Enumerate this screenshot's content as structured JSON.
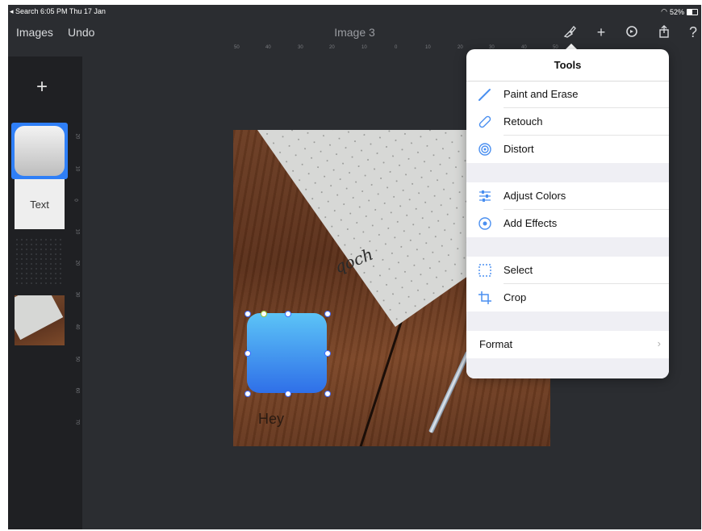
{
  "status": {
    "left": "◂ Search  6:05 PM  Thu 17 Jan",
    "right": "52%"
  },
  "nav": {
    "images_label": "Images",
    "undo_label": "Undo",
    "title": "Image 3",
    "icons": [
      "brush-icon",
      "plus-icon",
      "settings-icon",
      "share-icon",
      "help-icon"
    ],
    "plus_glyph": "+",
    "help_glyph": "?"
  },
  "ruler_top": [
    "50",
    "40",
    "30",
    "20",
    "10",
    "0",
    "10",
    "20",
    "30",
    "40",
    "50"
  ],
  "ruler_left": [
    "20",
    "10",
    "0",
    "10",
    "20",
    "30",
    "40",
    "50",
    "60",
    "70"
  ],
  "sidebar": {
    "add_glyph": "+",
    "layers": [
      {
        "name": "rounded-rect-layer",
        "label": ""
      },
      {
        "name": "text-layer",
        "label": "Text"
      },
      {
        "name": "empty-layer",
        "label": ""
      },
      {
        "name": "photo-layer",
        "label": ""
      }
    ]
  },
  "canvas": {
    "caption_text": "Hey",
    "script_text": "qoch"
  },
  "tools": {
    "title": "Tools",
    "group1": [
      "Paint and Erase",
      "Retouch",
      "Distort"
    ],
    "group2": [
      "Adjust Colors",
      "Add Effects"
    ],
    "group3": [
      "Select",
      "Crop"
    ],
    "format_label": "Format",
    "chevron": "›"
  },
  "colors": {
    "accent": "#2f7ff7",
    "background": "#2b2d31",
    "sidebar": "#1f2023"
  }
}
